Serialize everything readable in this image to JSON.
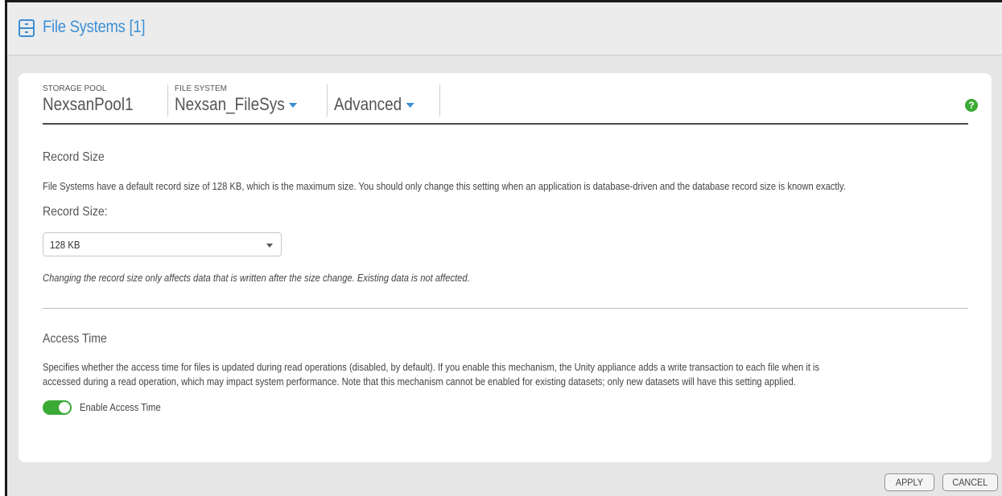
{
  "header": {
    "title": "File Systems [1]",
    "icon": "file-cabinet-icon",
    "accent_color": "#3b8fd6"
  },
  "breadcrumb": {
    "items": [
      {
        "label": "STORAGE POOL",
        "value": "NexsanPool1",
        "dropdown": false
      },
      {
        "label": "FILE SYSTEM",
        "value": "Nexsan_FileSys",
        "dropdown": true
      },
      {
        "label": "",
        "value": "Advanced",
        "dropdown": true
      }
    ],
    "help_icon": "help-icon",
    "help_glyph": "?"
  },
  "record_size": {
    "title": "Record Size",
    "description": "File Systems have a default record size of 128 KB, which is the maximum size. You should only change this setting when an application is database-driven and the database record size is known exactly.",
    "field_label": "Record Size:",
    "selected": "128 KB",
    "note": "Changing the record size only affects data that is written after the size change. Existing data is not affected."
  },
  "access_time": {
    "title": "Access Time",
    "description_line1": "Specifies whether the access time for files is updated during read operations (disabled, by default). If you enable this mechanism, the Unity appliance adds a write transaction to each file when it is",
    "description_line2": "accessed during a read operation, which may impact system performance. Note that this mechanism cannot be enabled for existing datasets; only new datasets will have this setting applied.",
    "toggle_label": "Enable Access Time",
    "toggle_on": true,
    "toggle_color": "#3aaa35"
  },
  "footer": {
    "apply_label": "APPLY",
    "cancel_label": "CANCEL"
  }
}
